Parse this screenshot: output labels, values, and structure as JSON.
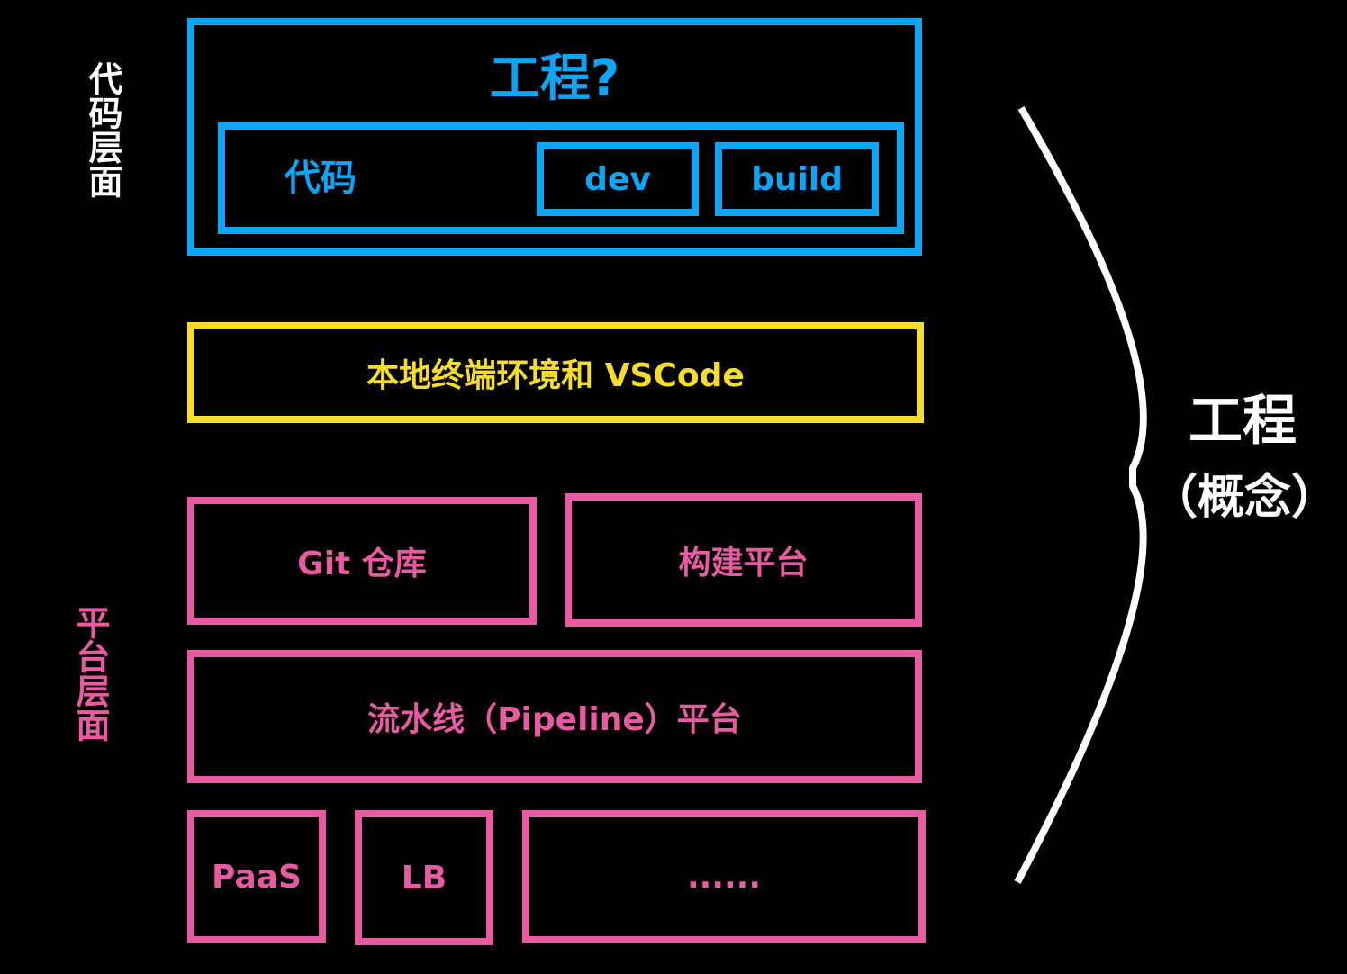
{
  "code_level": {
    "side_label": "代码层面",
    "title": "工程?",
    "code_label": "代码",
    "dev": "dev",
    "build": "build"
  },
  "local_env": {
    "label": "本地终端环境和 VSCode"
  },
  "platform_level": {
    "side_label": "平台层面",
    "git_repo": "Git 仓库",
    "build_platform": "构建平台",
    "pipeline": "流水线（Pipeline）平台",
    "paas": "PaaS",
    "lb": "LB",
    "more": "......"
  },
  "engineering": {
    "title": "工程",
    "subtitle": "（概念）"
  },
  "colors": {
    "code": "#0ea5f5",
    "local": "#f5dc2e",
    "platform": "#e85ba3",
    "concept": "#ffffff"
  }
}
